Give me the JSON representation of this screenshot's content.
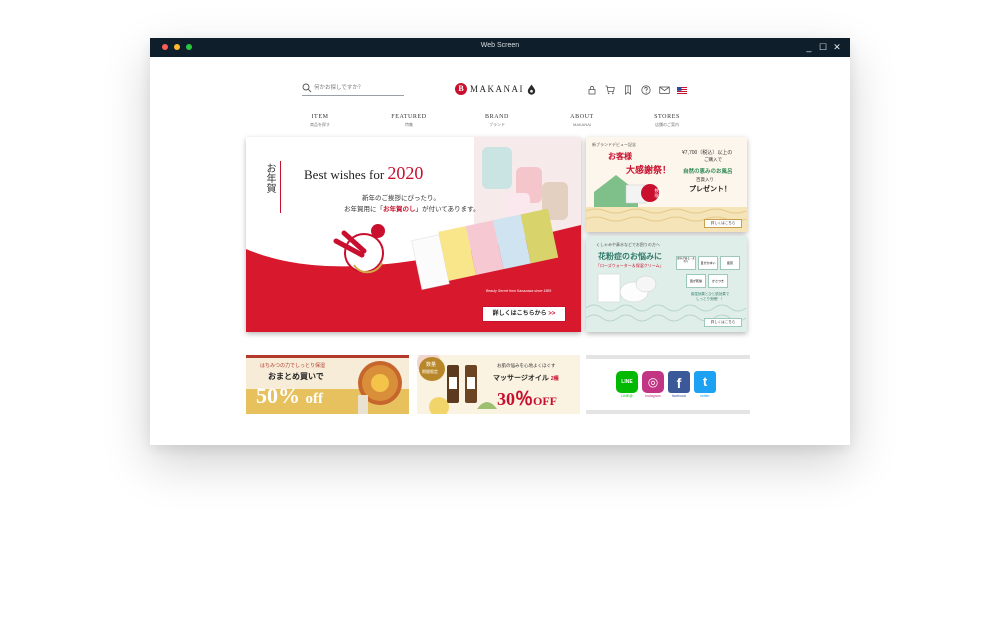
{
  "window": {
    "title": "Web Screen",
    "controls": [
      "_",
      "☐",
      "✕"
    ]
  },
  "header": {
    "search": {
      "placeholder": "何かお探しですか？"
    },
    "logo": {
      "mark": "B",
      "text": "MAKANAI"
    },
    "icons": [
      "lock-icon",
      "cart-icon",
      "bookmark-icon",
      "help-icon",
      "mail-icon",
      "us-flag-icon"
    ]
  },
  "nav": [
    {
      "en": "ITEM",
      "ja": "商品を探す"
    },
    {
      "en": "FEATURED",
      "ja": "特集"
    },
    {
      "en": "BRAND",
      "ja": "ブランド"
    },
    {
      "en": "ABOUT",
      "ja": "MAKANAI"
    },
    {
      "en": "STORES",
      "ja": "店舗のご案内"
    }
  ],
  "hero": {
    "vertical_text": "お年賀",
    "title": "Best wishes for ",
    "year": "2020",
    "line1": "新年のご挨拶にぴったり。",
    "line2_pre": "お年賀用に「",
    "line2_highlight": "お年賀のし",
    "line2_post": "」が付いてあります。",
    "credit": "Beauty Secret from Kanazawa since 1889",
    "button": "詳しくはこちらから",
    "button_arrow": ">>"
  },
  "promo_thanks": {
    "tag": "新ブランドデビュー記念",
    "badge_line1": "お客様",
    "badge_line2": "大感謝祭！",
    "amount": "¥7,700",
    "amount_suffix": "（税込）以上の",
    "purchase": "ご購入で",
    "gift": "自然の恵みのお風呂",
    "gift2": "百貨入り",
    "present": "プレゼント！",
    "stamp": "数量限定",
    "button": "詳しくはこちら"
  },
  "promo_pollen": {
    "tag": "くしゃみや鼻水などでお困りの方へ",
    "title": "花粉症のお悩みに",
    "subtitle": "「ローズウォーター＆保湿クリーム」",
    "chips": [
      "鼻水が出る・まわり",
      "目がかゆい",
      "肌荒",
      "肌が乾燥",
      "かさつき"
    ],
    "note": "保湿効果とひと肌効果で\nしっとり安眠！！",
    "button": "詳しくはこちら"
  },
  "banner_honey": {
    "tag": "はちみつの力でしっとり保湿",
    "title": "おまとめ買いで",
    "big": "50%",
    "off": "off"
  },
  "banner_oil": {
    "tag1": "数量",
    "tag2": "期間限定",
    "sub": "お肌の悩みを心地よくほぐす",
    "title": "マッサージオイル",
    "count": "2種",
    "big": "30％",
    "off": "OFF"
  },
  "banner_social": {
    "items": [
      {
        "label": "LINE@",
        "glyph": "LINE",
        "color": "#00b900"
      },
      {
        "label": "Instagram",
        "glyph": "◎",
        "color": "#c13584"
      },
      {
        "label": "facebook",
        "glyph": "f",
        "color": "#3b5998"
      },
      {
        "label": "twitter",
        "glyph": "t",
        "color": "#1da1f2"
      }
    ]
  },
  "colors": {
    "brand_red": "#c8102e",
    "titlebar": "#0e1f2b",
    "gold": "#c8a050",
    "mint": "#cfe3dc"
  }
}
